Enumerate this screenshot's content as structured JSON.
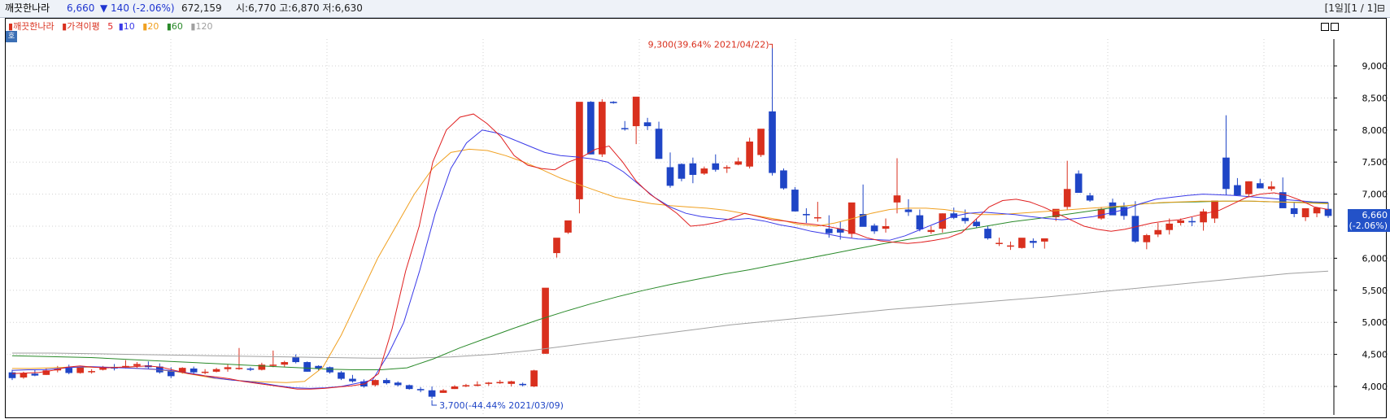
{
  "header": {
    "stock_name": "깨끗한나라",
    "price": "6,660",
    "change": "▼ 140 (-2.06%)",
    "volume": "672,159",
    "ohl": "시:6,770 고:6,870 저:6,630",
    "controls": "[1일][1 / 1]⊟"
  },
  "legend": {
    "stock": "깨끗한나라",
    "ma_label": "가격이평",
    "ma5": "5",
    "ma10": "10",
    "ma20": "20",
    "ma60": "60",
    "ma120": "120"
  },
  "corner_icon": "호",
  "colors": {
    "up": "#d9301e",
    "down": "#1f45c6",
    "ma5": "#e02020",
    "ma10": "#3a3ae8",
    "ma20": "#f0a020",
    "ma60": "#2a8a2a",
    "ma120": "#a0a0a0"
  },
  "price_tag": {
    "price": "6,660",
    "change": "(-2.06%)"
  },
  "chart_data": {
    "type": "candlestick",
    "y_ticks": [
      "9,000",
      "8,500",
      "8,000",
      "7,500",
      "7,000",
      "6,500",
      "6,000",
      "5,500",
      "5,000",
      "4,500",
      "4,000"
    ],
    "ylim": [
      3650,
      9550
    ],
    "annotations": {
      "high": "9,300(39.64% 2021/04/22)",
      "low": "3,700(-44.44% 2021/03/09)"
    },
    "candles": [
      [
        4220,
        4260,
        4100,
        4130
      ],
      [
        4140,
        4230,
        4120,
        4210
      ],
      [
        4200,
        4260,
        4160,
        4170
      ],
      [
        4180,
        4280,
        4180,
        4250
      ],
      [
        4250,
        4320,
        4220,
        4280
      ],
      [
        4290,
        4340,
        4190,
        4210
      ],
      [
        4210,
        4310,
        4200,
        4300
      ],
      [
        4230,
        4270,
        4200,
        4240
      ],
      [
        4260,
        4320,
        4250,
        4290
      ],
      [
        4300,
        4350,
        4250,
        4280
      ],
      [
        4300,
        4410,
        4280,
        4320
      ],
      [
        4320,
        4380,
        4290,
        4350
      ],
      [
        4330,
        4390,
        4280,
        4300
      ],
      [
        4310,
        4360,
        4200,
        4220
      ],
      [
        4240,
        4300,
        4130,
        4160
      ],
      [
        4220,
        4300,
        4200,
        4290
      ],
      [
        4280,
        4310,
        4200,
        4220
      ],
      [
        4220,
        4270,
        4190,
        4230
      ],
      [
        4230,
        4290,
        4220,
        4270
      ],
      [
        4270,
        4350,
        4230,
        4300
      ],
      [
        4280,
        4600,
        4260,
        4290
      ],
      [
        4280,
        4300,
        4240,
        4260
      ],
      [
        4260,
        4370,
        4250,
        4340
      ],
      [
        4330,
        4560,
        4300,
        4340
      ],
      [
        4340,
        4400,
        4300,
        4380
      ],
      [
        4460,
        4500,
        4360,
        4380
      ],
      [
        4380,
        4390,
        4230,
        4230
      ],
      [
        4320,
        4330,
        4250,
        4280
      ],
      [
        4300,
        4310,
        4200,
        4220
      ],
      [
        4220,
        4240,
        4100,
        4120
      ],
      [
        4120,
        4180,
        4060,
        4080
      ],
      [
        4080,
        4110,
        3980,
        4000
      ],
      [
        4020,
        4110,
        4000,
        4100
      ],
      [
        4100,
        4130,
        4030,
        4050
      ],
      [
        4060,
        4080,
        4000,
        4020
      ],
      [
        4020,
        4030,
        3950,
        3960
      ],
      [
        3960,
        3990,
        3910,
        3940
      ],
      [
        3940,
        4000,
        3810,
        3840
      ],
      [
        3900,
        3960,
        3900,
        3940
      ],
      [
        3960,
        4020,
        3960,
        4000
      ],
      [
        4000,
        4040,
        3990,
        4020
      ],
      [
        4010,
        4080,
        4000,
        4030
      ],
      [
        4040,
        4070,
        4010,
        4060
      ],
      [
        4050,
        4100,
        4040,
        4070
      ],
      [
        4040,
        4090,
        4000,
        4080
      ],
      [
        4040,
        4060,
        4000,
        4020
      ],
      [
        4000,
        4260,
        3990,
        4250
      ],
      [
        4510,
        5510,
        4510,
        5540
      ],
      [
        6080,
        6310,
        6010,
        6320
      ],
      [
        6400,
        6560,
        6380,
        6590
      ],
      [
        6920,
        7050,
        6700,
        8440
      ],
      [
        8440,
        8450,
        7620,
        7620
      ],
      [
        7620,
        8480,
        7580,
        8440
      ],
      [
        8440,
        8450,
        8410,
        8420
      ],
      [
        8030,
        8140,
        7990,
        8020
      ],
      [
        8060,
        8340,
        7780,
        8520
      ],
      [
        8120,
        8190,
        8000,
        8060
      ],
      [
        8020,
        8130,
        7550,
        7550
      ],
      [
        7420,
        7650,
        7100,
        7130
      ],
      [
        7470,
        7480,
        7200,
        7240
      ],
      [
        7480,
        7570,
        7170,
        7300
      ],
      [
        7320,
        7430,
        7300,
        7400
      ],
      [
        7480,
        7620,
        7350,
        7380
      ],
      [
        7400,
        7450,
        7330,
        7420
      ],
      [
        7460,
        7570,
        7450,
        7510
      ],
      [
        7430,
        7880,
        7400,
        7820
      ],
      [
        7610,
        8010,
        7580,
        8020
      ],
      [
        8290,
        9300,
        7290,
        7330
      ],
      [
        7370,
        7400,
        7070,
        7090
      ],
      [
        7070,
        7110,
        6730,
        6730
      ],
      [
        6690,
        6780,
        6550,
        6670
      ],
      [
        6630,
        6880,
        6570,
        6640
      ],
      [
        6460,
        6670,
        6320,
        6390
      ],
      [
        6460,
        6570,
        6290,
        6400
      ],
      [
        6380,
        6770,
        6320,
        6870
      ],
      [
        6690,
        7150,
        6520,
        6490
      ],
      [
        6510,
        6540,
        6380,
        6420
      ],
      [
        6460,
        6620,
        6400,
        6500
      ],
      [
        6870,
        7560,
        6700,
        6980
      ],
      [
        6760,
        6920,
        6660,
        6720
      ],
      [
        6670,
        6760,
        6420,
        6450
      ],
      [
        6410,
        6500,
        6380,
        6440
      ],
      [
        6460,
        6700,
        6400,
        6700
      ],
      [
        6700,
        6790,
        6610,
        6630
      ],
      [
        6630,
        6760,
        6540,
        6580
      ],
      [
        6570,
        6610,
        6480,
        6500
      ],
      [
        6460,
        6510,
        6290,
        6310
      ],
      [
        6230,
        6320,
        6190,
        6240
      ],
      [
        6180,
        6260,
        6130,
        6200
      ],
      [
        6160,
        6270,
        6150,
        6320
      ],
      [
        6270,
        6310,
        6160,
        6240
      ],
      [
        6260,
        6310,
        6150,
        6310
      ],
      [
        6640,
        6720,
        6580,
        6770
      ],
      [
        6800,
        7520,
        6760,
        7080
      ],
      [
        7320,
        7370,
        7020,
        7020
      ],
      [
        6980,
        7020,
        6880,
        6900
      ],
      [
        6620,
        6800,
        6600,
        6770
      ],
      [
        6870,
        6930,
        6700,
        6670
      ],
      [
        6800,
        6870,
        6600,
        6660
      ],
      [
        6660,
        6890,
        6240,
        6260
      ],
      [
        6250,
        6380,
        6140,
        6360
      ],
      [
        6370,
        6550,
        6330,
        6440
      ],
      [
        6440,
        6620,
        6370,
        6540
      ],
      [
        6550,
        6620,
        6510,
        6590
      ],
      [
        6580,
        6640,
        6500,
        6560
      ],
      [
        6560,
        6770,
        6430,
        6730
      ],
      [
        6620,
        6790,
        6550,
        6900
      ],
      [
        7570,
        8230,
        6990,
        7080
      ],
      [
        7140,
        7250,
        7000,
        6980
      ],
      [
        7000,
        7200,
        6950,
        7200
      ],
      [
        7170,
        7240,
        7100,
        7090
      ],
      [
        7080,
        7200,
        7050,
        7120
      ],
      [
        7030,
        7260,
        6880,
        6780
      ],
      [
        6780,
        6880,
        6640,
        6690
      ],
      [
        6640,
        6780,
        6580,
        6780
      ],
      [
        6700,
        6780,
        6640,
        6790
      ],
      [
        6770,
        6870,
        6630,
        6660
      ]
    ],
    "ma5": [
      4200,
      4210,
      4220,
      4250,
      4300,
      4320,
      4300,
      4290,
      4300,
      4310,
      4320,
      4300,
      4250,
      4200,
      4170,
      4150,
      4120,
      4080,
      4050,
      4020,
      3990,
      3960,
      3960,
      3970,
      3990,
      4010,
      4040,
      4200,
      4900,
      5800,
      6500,
      7500,
      8000,
      8200,
      8250,
      8100,
      7900,
      7600,
      7450,
      7400,
      7380,
      7500,
      7580,
      7700,
      7750,
      7500,
      7200,
      7000,
      6850,
      6700,
      6500,
      6520,
      6560,
      6620,
      6700,
      6650,
      6600,
      6580,
      6550,
      6530,
      6500,
      6460,
      6400,
      6320,
      6270,
      6250,
      6230,
      6250,
      6280,
      6320,
      6400,
      6600,
      6800,
      6900,
      6920,
      6880,
      6800,
      6700,
      6600,
      6500,
      6450,
      6420,
      6450,
      6500,
      6550,
      6580,
      6600,
      6650,
      6700,
      6750,
      6850,
      6950,
      7000,
      7020,
      6980,
      6900,
      6800,
      6760
    ],
    "ma10": [
      4250,
      4260,
      4260,
      4280,
      4300,
      4310,
      4300,
      4290,
      4280,
      4270,
      4250,
      4220,
      4180,
      4130,
      4100,
      4080,
      4050,
      4010,
      3980,
      3970,
      3980,
      4000,
      4050,
      4100,
      4500,
      5000,
      5800,
      6700,
      7400,
      7800,
      8000,
      7950,
      7850,
      7750,
      7650,
      7600,
      7580,
      7550,
      7500,
      7350,
      7150,
      6950,
      6800,
      6700,
      6650,
      6620,
      6600,
      6620,
      6580,
      6520,
      6480,
      6420,
      6380,
      6330,
      6300,
      6290,
      6280,
      6350,
      6450,
      6550,
      6650,
      6700,
      6720,
      6700,
      6680,
      6650,
      6620,
      6600,
      6620,
      6650,
      6700,
      6760,
      6850,
      6920,
      6950,
      6980,
      7000,
      6990,
      6980,
      6960,
      6940,
      6920,
      6900,
      6880,
      6870
    ],
    "ma20": [
      4280,
      4280,
      4290,
      4300,
      4300,
      4300,
      4300,
      4280,
      4260,
      4230,
      4180,
      4130,
      4100,
      4080,
      4070,
      4060,
      4080,
      4300,
      4800,
      5400,
      6000,
      6500,
      7000,
      7400,
      7650,
      7700,
      7680,
      7600,
      7500,
      7380,
      7250,
      7150,
      7050,
      6950,
      6900,
      6850,
      6820,
      6800,
      6780,
      6750,
      6700,
      6650,
      6600,
      6530,
      6500,
      6550,
      6620,
      6700,
      6760,
      6780,
      6780,
      6760,
      6720,
      6680,
      6680,
      6700,
      6720,
      6740,
      6760,
      6780,
      6800,
      6820,
      6850,
      6870,
      6880,
      6890,
      6890,
      6890,
      6890,
      6880,
      6870,
      6860,
      6850
    ],
    "ma60": [
      4480,
      4470,
      4460,
      4450,
      4430,
      4410,
      4390,
      4370,
      4350,
      4330,
      4310,
      4290,
      4270,
      4260,
      4260,
      4290,
      4430,
      4600,
      4750,
      4900,
      5040,
      5170,
      5290,
      5400,
      5500,
      5590,
      5670,
      5750,
      5820,
      5900,
      5980,
      6060,
      6140,
      6220,
      6290,
      6360,
      6430,
      6500,
      6570,
      6620,
      6680,
      6740,
      6800,
      6850,
      6870,
      6880,
      6890,
      6890,
      6880,
      6870,
      6860
    ],
    "ma120": [
      4520,
      4520,
      4510,
      4500,
      4490,
      4480,
      4470,
      4460,
      4450,
      4440,
      4440,
      4460,
      4500,
      4560,
      4640,
      4720,
      4800,
      4880,
      4960,
      5020,
      5080,
      5140,
      5200,
      5250,
      5300,
      5350,
      5400,
      5460,
      5520,
      5580,
      5640,
      5700,
      5760,
      5800
    ]
  }
}
